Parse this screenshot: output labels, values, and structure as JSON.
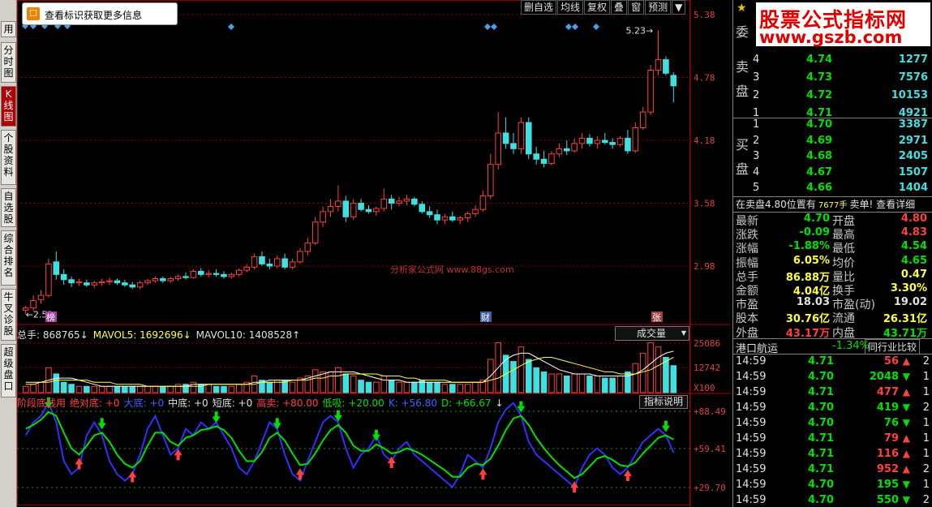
{
  "left_tabs": [
    {
      "label": "用",
      "active": false
    },
    {
      "label": "分时图",
      "active": false
    },
    {
      "label": "K线图",
      "active": true
    },
    {
      "label": "个股资料",
      "active": false
    },
    {
      "label": "自选股",
      "active": false
    },
    {
      "label": "综合排名",
      "active": false
    },
    {
      "label": "牛叉诊股",
      "active": false
    },
    {
      "label": "超级盘口",
      "active": false
    }
  ],
  "tooltip": {
    "text": "查看标识获取更多信息"
  },
  "chart_buttons": [
    "删自选",
    "均线",
    "复权",
    "叠",
    "窗",
    "预测"
  ],
  "price_axis": [
    "5.38",
    "4.78",
    "4.18",
    "3.58",
    "2.98"
  ],
  "volume_axis": [
    "25086",
    "12742",
    "X100"
  ],
  "indicator_axis": [
    "+88.49",
    "+59.41",
    "+29.70"
  ],
  "annotations": {
    "high": "5.23",
    "low": "2.52",
    "marker_left": "榜",
    "marker_mid": "财",
    "marker_right": "张"
  },
  "watermark": "分析家公式网 www.88gs.com",
  "volume_line": [
    {
      "label": "总手: ",
      "value": "868765",
      "arrow": "↓",
      "color": "#e0e0e0"
    },
    {
      "label": "MAVOL5: ",
      "value": "1692696",
      "arrow": "↓",
      "color": "#ffff40"
    },
    {
      "label": "MAVOL10: ",
      "value": "1408528",
      "arrow": "↑",
      "color": "#e0e0e0"
    }
  ],
  "volume_dropdown": "成交量",
  "indicator_line": [
    {
      "text": "阶段底线用",
      "color": "#ff4040"
    },
    {
      "text": "绝对底: +0",
      "color": "#ff4040"
    },
    {
      "text": "大底: +0",
      "color": "#4060ff"
    },
    {
      "text": "中底: +0",
      "color": "#e0e0e0"
    },
    {
      "text": "短底: +0",
      "color": "#e0e0e0"
    },
    {
      "text": "高卖: +80.00",
      "color": "#ff4040"
    },
    {
      "text": "低吸: +20.00",
      "color": "#00e000"
    },
    {
      "text": "K: +56.80",
      "color": "#4060ff"
    },
    {
      "text": "D: +66.67",
      "color": "#00e000"
    },
    {
      "text": "↓",
      "color": "#e0e0e0"
    }
  ],
  "indicator_button": "指标说明",
  "banner": {
    "title": "股票公式指标网",
    "url": "www.gszb.com"
  },
  "panel_label_wei": "委",
  "sell_label": "卖盘",
  "buy_label": "买盘",
  "sell_orders": [
    {
      "level": "4",
      "price": "4.74",
      "qty": "1277"
    },
    {
      "level": "3",
      "price": "4.73",
      "qty": "7576"
    },
    {
      "level": "2",
      "price": "4.72",
      "qty": "10153"
    },
    {
      "level": "1",
      "price": "4.71",
      "qty": "4921"
    }
  ],
  "buy_orders": [
    {
      "level": "1",
      "price": "4.70",
      "qty": "3387"
    },
    {
      "level": "2",
      "price": "4.69",
      "qty": "2971"
    },
    {
      "level": "3",
      "price": "4.68",
      "qty": "2405"
    },
    {
      "level": "4",
      "price": "4.67",
      "qty": "1507"
    },
    {
      "level": "5",
      "price": "4.66",
      "qty": "1404"
    }
  ],
  "notice": {
    "prefix": "在卖盘4.80位置有",
    "qty": "7677手",
    "suffix": "卖单!",
    "link": "查看详细"
  },
  "stats": [
    {
      "l1": "最新",
      "v1": "4.70",
      "c1": "green",
      "l2": "开盘",
      "v2": "4.80",
      "c2": "red"
    },
    {
      "l1": "涨跌",
      "v1": "-0.09",
      "c1": "green",
      "l2": "最高",
      "v2": "4.83",
      "c2": "red"
    },
    {
      "l1": "涨幅",
      "v1": "-1.88%",
      "c1": "green",
      "l2": "最低",
      "v2": "4.54",
      "c2": "green"
    },
    {
      "l1": "振幅",
      "v1": "6.05%",
      "c1": "yellow",
      "l2": "均价",
      "v2": "4.65",
      "c2": "green"
    },
    {
      "l1": "总手",
      "v1": "86.88万",
      "c1": "yellow",
      "l2": "量比",
      "v2": "0.47",
      "c2": "yellow"
    },
    {
      "l1": "金额",
      "v1": "4.04亿",
      "c1": "yellow",
      "l2": "换手",
      "v2": "3.30%",
      "c2": "yellow"
    },
    {
      "l1": "市盈",
      "v1": "18.03",
      "c1": "white",
      "l2": "市盈(动)",
      "v2": "19.02",
      "c2": "white"
    },
    {
      "l1": "股本",
      "v1": "30.76亿",
      "c1": "yellow",
      "l2": "流通",
      "v2": "26.31亿",
      "c2": "yellow"
    },
    {
      "l1": "外盘",
      "v1": "43.17万",
      "c1": "red",
      "l2": "内盘",
      "v2": "43.71万",
      "c2": "green"
    }
  ],
  "sector": {
    "name": "港口航运",
    "change": "-1.34%",
    "button": "同行业比较"
  },
  "ticks": [
    {
      "time": "14:59",
      "price": "4.71",
      "vol": "56",
      "dir": "up",
      "n": "2"
    },
    {
      "time": "14:59",
      "price": "4.70",
      "vol": "2048",
      "dir": "down",
      "n": "1"
    },
    {
      "time": "14:59",
      "price": "4.71",
      "vol": "477",
      "dir": "up",
      "n": "1"
    },
    {
      "time": "14:59",
      "price": "4.70",
      "vol": "419",
      "dir": "down",
      "n": "2"
    },
    {
      "time": "14:59",
      "price": "4.70",
      "vol": "76",
      "dir": "down",
      "n": "1"
    },
    {
      "time": "14:59",
      "price": "4.71",
      "vol": "79",
      "dir": "up",
      "n": "1"
    },
    {
      "time": "14:59",
      "price": "4.71",
      "vol": "116",
      "dir": "up",
      "n": "1"
    },
    {
      "time": "14:59",
      "price": "4.71",
      "vol": "952",
      "dir": "up",
      "n": "2"
    },
    {
      "time": "14:59",
      "price": "4.70",
      "vol": "195",
      "dir": "down",
      "n": "1"
    },
    {
      "time": "14:59",
      "price": "4.70",
      "vol": "550",
      "dir": "down",
      "n": "2"
    }
  ],
  "colors": {
    "up": "#ff4040",
    "down": "#40e0e0",
    "ma5": "#ffffff",
    "ma10": "#ffff40",
    "k_line": "#3030ff",
    "d_line": "#00e000",
    "grid": "#8b0000"
  },
  "chart_data": {
    "type": "candlestick",
    "y_range": [
      2.5,
      5.38
    ],
    "candles": [
      [
        2.56,
        2.6,
        2.52,
        2.58
      ],
      [
        2.58,
        2.7,
        2.55,
        2.65
      ],
      [
        2.66,
        2.75,
        2.62,
        2.7
      ],
      [
        2.7,
        3.05,
        2.68,
        3.0
      ],
      [
        3.02,
        3.12,
        2.85,
        2.9
      ],
      [
        2.9,
        2.95,
        2.8,
        2.85
      ],
      [
        2.85,
        2.88,
        2.78,
        2.82
      ],
      [
        2.82,
        2.86,
        2.79,
        2.83
      ],
      [
        2.82,
        2.85,
        2.78,
        2.8
      ],
      [
        2.8,
        2.84,
        2.77,
        2.82
      ],
      [
        2.82,
        2.86,
        2.79,
        2.83
      ],
      [
        2.83,
        2.87,
        2.8,
        2.84
      ],
      [
        2.84,
        2.86,
        2.8,
        2.82
      ],
      [
        2.82,
        2.85,
        2.78,
        2.8
      ],
      [
        2.8,
        2.83,
        2.76,
        2.78
      ],
      [
        2.78,
        2.84,
        2.76,
        2.82
      ],
      [
        2.82,
        2.86,
        2.8,
        2.84
      ],
      [
        2.84,
        2.88,
        2.82,
        2.86
      ],
      [
        2.86,
        2.88,
        2.82,
        2.84
      ],
      [
        2.84,
        2.88,
        2.82,
        2.86
      ],
      [
        2.86,
        2.9,
        2.84,
        2.88
      ],
      [
        2.88,
        2.92,
        2.85,
        2.87
      ],
      [
        2.87,
        2.95,
        2.86,
        2.93
      ],
      [
        2.93,
        2.96,
        2.88,
        2.9
      ],
      [
        2.9,
        2.94,
        2.87,
        2.91
      ],
      [
        2.91,
        2.95,
        2.88,
        2.9
      ],
      [
        2.9,
        2.93,
        2.86,
        2.88
      ],
      [
        2.88,
        2.92,
        2.86,
        2.9
      ],
      [
        2.9,
        2.96,
        2.88,
        2.94
      ],
      [
        2.94,
        3.0,
        2.92,
        2.97
      ],
      [
        2.97,
        3.1,
        2.95,
        3.07
      ],
      [
        3.07,
        3.12,
        2.98,
        3.0
      ],
      [
        3.0,
        3.05,
        2.95,
        2.98
      ],
      [
        2.98,
        3.08,
        2.96,
        3.05
      ],
      [
        3.05,
        3.1,
        2.95,
        2.97
      ],
      [
        2.97,
        3.05,
        2.95,
        3.02
      ],
      [
        3.02,
        3.15,
        3.0,
        3.12
      ],
      [
        3.12,
        3.25,
        3.08,
        3.2
      ],
      [
        3.2,
        3.45,
        3.18,
        3.4
      ],
      [
        3.4,
        3.55,
        3.35,
        3.5
      ],
      [
        3.5,
        3.62,
        3.45,
        3.55
      ],
      [
        3.55,
        3.75,
        3.5,
        3.6
      ],
      [
        3.6,
        3.65,
        3.4,
        3.45
      ],
      [
        3.45,
        3.62,
        3.42,
        3.58
      ],
      [
        3.58,
        3.62,
        3.5,
        3.52
      ],
      [
        3.52,
        3.56,
        3.48,
        3.5
      ],
      [
        3.5,
        3.55,
        3.46,
        3.53
      ],
      [
        3.53,
        3.72,
        3.5,
        3.62
      ],
      [
        3.62,
        3.66,
        3.52,
        3.58
      ],
      [
        3.58,
        3.64,
        3.55,
        3.6
      ],
      [
        3.6,
        3.66,
        3.56,
        3.62
      ],
      [
        3.62,
        3.64,
        3.55,
        3.57
      ],
      [
        3.57,
        3.6,
        3.48,
        3.5
      ],
      [
        3.5,
        3.55,
        3.44,
        3.47
      ],
      [
        3.47,
        3.52,
        3.38,
        3.42
      ],
      [
        3.42,
        3.48,
        3.38,
        3.45
      ],
      [
        3.45,
        3.5,
        3.4,
        3.42
      ],
      [
        3.42,
        3.46,
        3.38,
        3.44
      ],
      [
        3.44,
        3.5,
        3.4,
        3.48
      ],
      [
        3.48,
        3.56,
        3.45,
        3.52
      ],
      [
        3.52,
        3.7,
        3.5,
        3.65
      ],
      [
        3.65,
        4.05,
        3.62,
        3.95
      ],
      [
        3.95,
        4.45,
        3.9,
        4.25
      ],
      [
        4.25,
        4.4,
        4.1,
        4.15
      ],
      [
        4.15,
        4.25,
        4.05,
        4.1
      ],
      [
        4.1,
        4.4,
        4.05,
        4.35
      ],
      [
        4.35,
        4.4,
        4.0,
        4.05
      ],
      [
        4.05,
        4.12,
        3.95,
        4.0
      ],
      [
        4.0,
        4.08,
        3.92,
        3.96
      ],
      [
        3.96,
        4.08,
        3.94,
        4.05
      ],
      [
        4.05,
        4.15,
        4.02,
        4.1
      ],
      [
        4.1,
        4.18,
        4.04,
        4.08
      ],
      [
        4.08,
        4.2,
        4.06,
        4.15
      ],
      [
        4.15,
        4.25,
        4.1,
        4.2
      ],
      [
        4.2,
        4.24,
        4.12,
        4.15
      ],
      [
        4.15,
        4.22,
        4.1,
        4.18
      ],
      [
        4.18,
        4.25,
        4.14,
        4.16
      ],
      [
        4.16,
        4.2,
        4.1,
        4.14
      ],
      [
        4.14,
        4.22,
        4.12,
        4.2
      ],
      [
        4.2,
        4.28,
        4.05,
        4.08
      ],
      [
        4.08,
        4.35,
        4.06,
        4.3
      ],
      [
        4.3,
        4.5,
        4.28,
        4.45
      ],
      [
        4.45,
        4.9,
        4.42,
        4.85
      ],
      [
        4.85,
        5.23,
        4.8,
        4.95
      ],
      [
        4.95,
        4.98,
        4.8,
        4.82
      ],
      [
        4.8,
        4.83,
        4.54,
        4.7
      ]
    ],
    "volumes": [
      3,
      4,
      5,
      12,
      9,
      5,
      4,
      3,
      3,
      3,
      3,
      3,
      3,
      3,
      3,
      3,
      3,
      3,
      3,
      3,
      4,
      4,
      5,
      4,
      4,
      3,
      3,
      3,
      4,
      5,
      8,
      6,
      5,
      6,
      6,
      5,
      7,
      8,
      11,
      10,
      10,
      12,
      9,
      8,
      6,
      5,
      5,
      8,
      6,
      5,
      5,
      5,
      6,
      5,
      5,
      4,
      4,
      4,
      4,
      5,
      6,
      16,
      24,
      18,
      15,
      22,
      16,
      12,
      10,
      9,
      9,
      8,
      9,
      9,
      8,
      8,
      7,
      7,
      8,
      10,
      14,
      19,
      24,
      22,
      17,
      13
    ],
    "ma5": [
      5,
      5,
      5,
      6,
      7,
      7,
      7,
      6,
      5,
      4,
      3,
      3,
      3,
      3,
      3,
      3,
      3,
      3,
      3,
      3,
      3,
      3,
      4,
      4,
      4,
      4,
      4,
      4,
      4,
      4,
      5,
      5,
      6,
      6,
      6,
      6,
      6,
      7,
      8,
      9,
      10,
      10,
      10,
      10,
      9,
      8,
      7,
      6,
      6,
      6,
      5,
      5,
      5,
      5,
      5,
      5,
      5,
      5,
      5,
      5,
      5,
      8,
      12,
      16,
      18,
      19,
      19,
      17,
      15,
      13,
      11,
      10,
      9,
      9,
      9,
      8,
      8,
      8,
      8,
      8,
      9,
      11,
      14,
      17,
      19,
      20
    ],
    "ma10": [
      4,
      4,
      5,
      5,
      6,
      6,
      6,
      6,
      6,
      5,
      5,
      5,
      4,
      4,
      4,
      4,
      3,
      3,
      3,
      3,
      3,
      3,
      3,
      3,
      4,
      4,
      4,
      4,
      4,
      4,
      4,
      5,
      5,
      5,
      5,
      6,
      6,
      6,
      7,
      7,
      8,
      8,
      9,
      9,
      9,
      9,
      9,
      8,
      8,
      8,
      7,
      7,
      6,
      6,
      6,
      6,
      5,
      5,
      5,
      5,
      5,
      6,
      7,
      9,
      11,
      13,
      15,
      16,
      17,
      17,
      16,
      15,
      14,
      13,
      12,
      11,
      10,
      10,
      9,
      9,
      9,
      10,
      11,
      13,
      15,
      17
    ],
    "k": [
      70,
      80,
      85,
      95,
      80,
      50,
      40,
      45,
      70,
      80,
      70,
      50,
      40,
      35,
      40,
      55,
      75,
      85,
      70,
      55,
      60,
      75,
      70,
      80,
      75,
      80,
      70,
      60,
      45,
      40,
      50,
      65,
      80,
      75,
      55,
      40,
      35,
      50,
      65,
      80,
      85,
      80,
      60,
      45,
      55,
      60,
      70,
      55,
      50,
      60,
      65,
      55,
      50,
      45,
      40,
      35,
      30,
      40,
      55,
      50,
      45,
      60,
      80,
      90,
      95,
      85,
      65,
      55,
      50,
      45,
      40,
      35,
      30,
      45,
      55,
      60,
      55,
      45,
      40,
      45,
      55,
      65,
      70,
      75,
      70,
      56.8
    ],
    "d": [
      75,
      78,
      82,
      88,
      85,
      72,
      60,
      55,
      62,
      70,
      72,
      65,
      55,
      48,
      45,
      50,
      62,
      72,
      72,
      65,
      62,
      68,
      70,
      74,
      75,
      77,
      74,
      68,
      58,
      50,
      50,
      57,
      68,
      72,
      66,
      56,
      47,
      48,
      56,
      66,
      74,
      78,
      72,
      62,
      58,
      58,
      63,
      60,
      56,
      57,
      60,
      58,
      55,
      51,
      47,
      43,
      38,
      38,
      45,
      48,
      47,
      52,
      62,
      74,
      83,
      85,
      78,
      68,
      60,
      53,
      47,
      42,
      37,
      40,
      46,
      52,
      54,
      51,
      47,
      46,
      49,
      56,
      62,
      68,
      70,
      66.7
    ]
  }
}
